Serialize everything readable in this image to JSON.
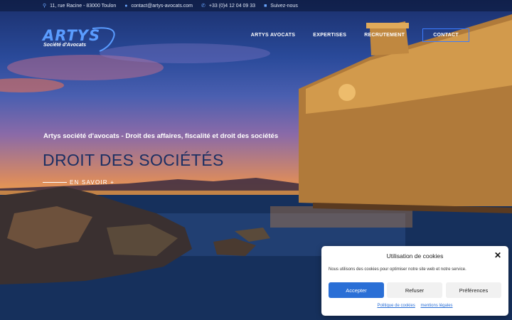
{
  "topbar": {
    "address": "11, rue Racine - 83000 Toulon",
    "email": "contact@artys-avocats.com",
    "phone": "+33 (0)4 12 04 09 33",
    "social": "Suivez-nous"
  },
  "logo": {
    "name": "ARTYS",
    "tagline": "Société d'Avocats"
  },
  "nav": {
    "items": [
      "ARTYS AVOCATS",
      "EXPERTISES",
      "RECRUTEMENT"
    ],
    "contact": "CONTACT"
  },
  "hero": {
    "kicker": "Artys société d'avocats - Droit des affaires, fiscalité et droit des sociétés",
    "headline": "DROIT DES SOCIÉTÉS",
    "cta": "EN SAVOIR +"
  },
  "cookie": {
    "title": "Utilisation de cookies",
    "close": "✕",
    "message": "Nous utilisons des cookies pour optimiser notre site web et notre service.",
    "accept": "Accepter",
    "refuse": "Refuser",
    "preferences": "Préférences",
    "policy_link": "Politique de cookies",
    "legal_link": "mentions légales"
  },
  "colors": {
    "accent": "#3b7cff",
    "headline": "#1b2f63",
    "accept_button": "#2a6fd6"
  }
}
